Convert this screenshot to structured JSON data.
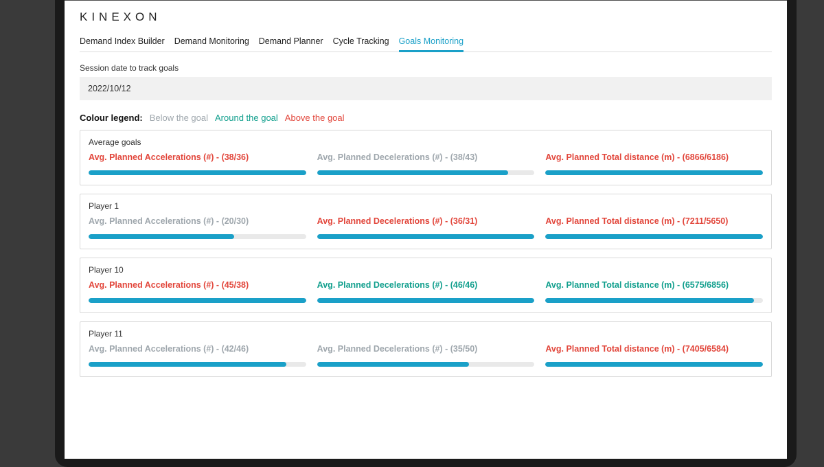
{
  "logo_text": "KINEXON",
  "tabs": [
    {
      "label": "Demand Index Builder",
      "active": false
    },
    {
      "label": "Demand Monitoring",
      "active": false
    },
    {
      "label": "Demand Planner",
      "active": false
    },
    {
      "label": "Cycle Tracking",
      "active": false
    },
    {
      "label": "Goals Monitoring",
      "active": true
    }
  ],
  "session_label": "Session date to track goals",
  "session_date": "2022/10/12",
  "legend": {
    "title": "Colour legend:",
    "below": "Below the goal",
    "around": "Around the goal",
    "above": "Above the goal"
  },
  "status_colors": {
    "below": "#9fa7ad",
    "around": "#119f8d",
    "above": "#e2463b"
  },
  "cards": [
    {
      "title": "Average goals",
      "metrics": [
        {
          "label": "Avg. Planned Accelerations (#) - (38/36)",
          "status": "above",
          "fill_pct": 100
        },
        {
          "label": "Avg. Planned Decelerations (#) - (38/43)",
          "status": "below",
          "fill_pct": 88
        },
        {
          "label": "Avg. Planned Total distance (m) - (6866/6186)",
          "status": "above",
          "fill_pct": 100
        }
      ]
    },
    {
      "title": "Player 1",
      "metrics": [
        {
          "label": "Avg. Planned Accelerations (#) - (20/30)",
          "status": "below",
          "fill_pct": 67
        },
        {
          "label": "Avg. Planned Decelerations (#) - (36/31)",
          "status": "above",
          "fill_pct": 100
        },
        {
          "label": "Avg. Planned Total distance (m) - (7211/5650)",
          "status": "above",
          "fill_pct": 100
        }
      ]
    },
    {
      "title": "Player 10",
      "metrics": [
        {
          "label": "Avg. Planned Accelerations (#) - (45/38)",
          "status": "above",
          "fill_pct": 100
        },
        {
          "label": "Avg. Planned Decelerations (#) - (46/46)",
          "status": "around",
          "fill_pct": 100
        },
        {
          "label": "Avg. Planned Total distance (m) - (6575/6856)",
          "status": "around",
          "fill_pct": 96
        }
      ]
    },
    {
      "title": "Player 11",
      "metrics": [
        {
          "label": "Avg. Planned Accelerations (#) - (42/46)",
          "status": "below",
          "fill_pct": 91
        },
        {
          "label": "Avg. Planned Decelerations (#) - (35/50)",
          "status": "below",
          "fill_pct": 70
        },
        {
          "label": "Avg. Planned Total distance (m) - (7405/6584)",
          "status": "above",
          "fill_pct": 100
        }
      ]
    }
  ]
}
